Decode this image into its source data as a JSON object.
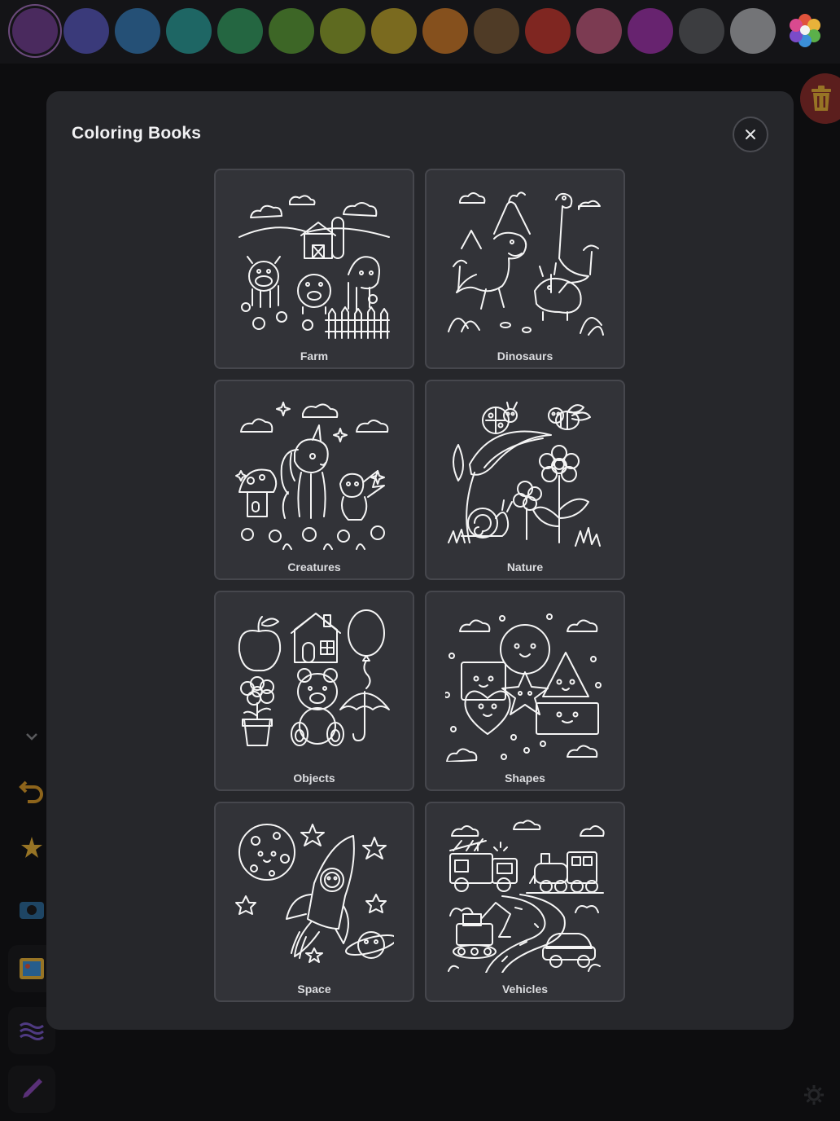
{
  "palette": {
    "colors": [
      "#4a2a5e",
      "#3a3a7a",
      "#255076",
      "#1e6664",
      "#246641",
      "#3d6626",
      "#5e6a20",
      "#7a6a1f",
      "#85501d",
      "#4f3b26",
      "#7f2621",
      "#7c3b52",
      "#67236f",
      "#3c3d40",
      "#737477"
    ],
    "selected_index": 0,
    "custom_icon": "rainbow-flower-icon"
  },
  "toolbar": {
    "trash_icon": "trash-icon",
    "tools": [
      "chevron-down-icon",
      "undo-icon",
      "magic-star-icon",
      "camera-icon",
      "coloring-book-icon",
      "waves-icon",
      "brush-icon"
    ],
    "settings_icon": "gear-icon"
  },
  "modal": {
    "title": "Coloring Books",
    "close_icon": "close-icon",
    "books": [
      {
        "label": "Farm",
        "art": "farm"
      },
      {
        "label": "Dinosaurs",
        "art": "dinosaurs"
      },
      {
        "label": "Creatures",
        "art": "creatures"
      },
      {
        "label": "Nature",
        "art": "nature"
      },
      {
        "label": "Objects",
        "art": "objects"
      },
      {
        "label": "Shapes",
        "art": "shapes"
      },
      {
        "label": "Space",
        "art": "space"
      },
      {
        "label": "Vehicles",
        "art": "vehicles"
      }
    ]
  }
}
